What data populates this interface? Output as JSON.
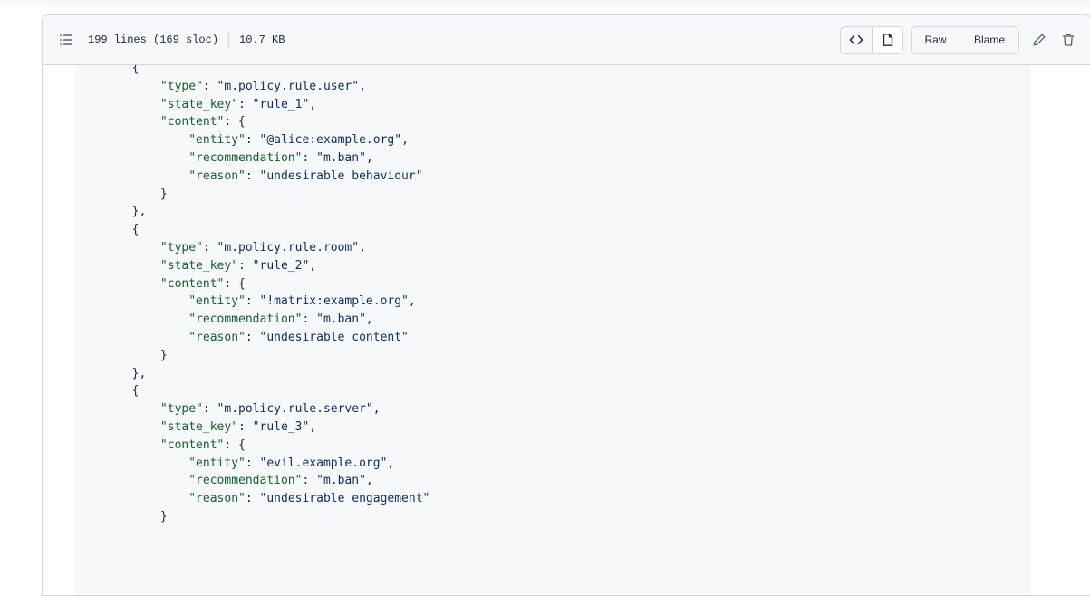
{
  "file_header": {
    "lines_info": "199 lines (169 sloc)",
    "size": "10.7 KB",
    "raw_label": "Raw",
    "blame_label": "Blame",
    "icons": {
      "outline": "list-outline-icon",
      "code_view": "code-icon",
      "preview": "file-icon",
      "edit": "pencil-icon",
      "delete": "trash-icon"
    }
  },
  "colors": {
    "key": "#116329",
    "string": "#0a3069",
    "punctuation": "#24292f",
    "code_background": "#f6f8fa",
    "border": "#d0d7de"
  },
  "code": {
    "lines": [
      {
        "indent": "        ",
        "parts": [
          {
            "t": "p",
            "v": "{"
          }
        ]
      },
      {
        "indent": "            ",
        "parts": [
          {
            "t": "k",
            "v": "\"type\""
          },
          {
            "t": "p",
            "v": ": "
          },
          {
            "t": "s",
            "v": "\"m.policy.rule.user\""
          },
          {
            "t": "p",
            "v": ","
          }
        ]
      },
      {
        "indent": "            ",
        "parts": [
          {
            "t": "k",
            "v": "\"state_key\""
          },
          {
            "t": "p",
            "v": ": "
          },
          {
            "t": "s",
            "v": "\"rule_1\""
          },
          {
            "t": "p",
            "v": ","
          }
        ]
      },
      {
        "indent": "            ",
        "parts": [
          {
            "t": "k",
            "v": "\"content\""
          },
          {
            "t": "p",
            "v": ": {"
          }
        ]
      },
      {
        "indent": "                ",
        "parts": [
          {
            "t": "k",
            "v": "\"entity\""
          },
          {
            "t": "p",
            "v": ": "
          },
          {
            "t": "s",
            "v": "\"@alice:example.org\""
          },
          {
            "t": "p",
            "v": ","
          }
        ]
      },
      {
        "indent": "                ",
        "parts": [
          {
            "t": "k",
            "v": "\"recommendation\""
          },
          {
            "t": "p",
            "v": ": "
          },
          {
            "t": "s",
            "v": "\"m.ban\""
          },
          {
            "t": "p",
            "v": ","
          }
        ]
      },
      {
        "indent": "                ",
        "parts": [
          {
            "t": "k",
            "v": "\"reason\""
          },
          {
            "t": "p",
            "v": ": "
          },
          {
            "t": "s",
            "v": "\"undesirable behaviour\""
          }
        ]
      },
      {
        "indent": "            ",
        "parts": [
          {
            "t": "p",
            "v": "}"
          }
        ]
      },
      {
        "indent": "        ",
        "parts": [
          {
            "t": "p",
            "v": "},"
          }
        ]
      },
      {
        "indent": "        ",
        "parts": [
          {
            "t": "p",
            "v": "{"
          }
        ]
      },
      {
        "indent": "            ",
        "parts": [
          {
            "t": "k",
            "v": "\"type\""
          },
          {
            "t": "p",
            "v": ": "
          },
          {
            "t": "s",
            "v": "\"m.policy.rule.room\""
          },
          {
            "t": "p",
            "v": ","
          }
        ]
      },
      {
        "indent": "            ",
        "parts": [
          {
            "t": "k",
            "v": "\"state_key\""
          },
          {
            "t": "p",
            "v": ": "
          },
          {
            "t": "s",
            "v": "\"rule_2\""
          },
          {
            "t": "p",
            "v": ","
          }
        ]
      },
      {
        "indent": "            ",
        "parts": [
          {
            "t": "k",
            "v": "\"content\""
          },
          {
            "t": "p",
            "v": ": {"
          }
        ]
      },
      {
        "indent": "                ",
        "parts": [
          {
            "t": "k",
            "v": "\"entity\""
          },
          {
            "t": "p",
            "v": ": "
          },
          {
            "t": "s",
            "v": "\"!matrix:example.org\""
          },
          {
            "t": "p",
            "v": ","
          }
        ]
      },
      {
        "indent": "                ",
        "parts": [
          {
            "t": "k",
            "v": "\"recommendation\""
          },
          {
            "t": "p",
            "v": ": "
          },
          {
            "t": "s",
            "v": "\"m.ban\""
          },
          {
            "t": "p",
            "v": ","
          }
        ]
      },
      {
        "indent": "                ",
        "parts": [
          {
            "t": "k",
            "v": "\"reason\""
          },
          {
            "t": "p",
            "v": ": "
          },
          {
            "t": "s",
            "v": "\"undesirable content\""
          }
        ]
      },
      {
        "indent": "            ",
        "parts": [
          {
            "t": "p",
            "v": "}"
          }
        ]
      },
      {
        "indent": "        ",
        "parts": [
          {
            "t": "p",
            "v": "},"
          }
        ]
      },
      {
        "indent": "        ",
        "parts": [
          {
            "t": "p",
            "v": "{"
          }
        ]
      },
      {
        "indent": "            ",
        "parts": [
          {
            "t": "k",
            "v": "\"type\""
          },
          {
            "t": "p",
            "v": ": "
          },
          {
            "t": "s",
            "v": "\"m.policy.rule.server\""
          },
          {
            "t": "p",
            "v": ","
          }
        ]
      },
      {
        "indent": "            ",
        "parts": [
          {
            "t": "k",
            "v": "\"state_key\""
          },
          {
            "t": "p",
            "v": ": "
          },
          {
            "t": "s",
            "v": "\"rule_3\""
          },
          {
            "t": "p",
            "v": ","
          }
        ]
      },
      {
        "indent": "            ",
        "parts": [
          {
            "t": "k",
            "v": "\"content\""
          },
          {
            "t": "p",
            "v": ": {"
          }
        ]
      },
      {
        "indent": "                ",
        "parts": [
          {
            "t": "k",
            "v": "\"entity\""
          },
          {
            "t": "p",
            "v": ": "
          },
          {
            "t": "s",
            "v": "\"evil.example.org\""
          },
          {
            "t": "p",
            "v": ","
          }
        ]
      },
      {
        "indent": "                ",
        "parts": [
          {
            "t": "k",
            "v": "\"recommendation\""
          },
          {
            "t": "p",
            "v": ": "
          },
          {
            "t": "s",
            "v": "\"m.ban\""
          },
          {
            "t": "p",
            "v": ","
          }
        ]
      },
      {
        "indent": "                ",
        "parts": [
          {
            "t": "k",
            "v": "\"reason\""
          },
          {
            "t": "p",
            "v": ": "
          },
          {
            "t": "s",
            "v": "\"undesirable engagement\""
          }
        ]
      },
      {
        "indent": "            ",
        "parts": [
          {
            "t": "p",
            "v": "}"
          }
        ]
      }
    ]
  }
}
